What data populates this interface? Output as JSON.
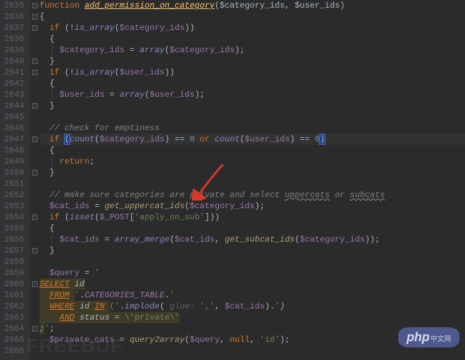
{
  "lines": {
    "start": 2635,
    "end": 2666
  },
  "code": {
    "l2635": {
      "kw": "function",
      "name": "add_permission_on_category",
      "params": "($category_ids, $user_ids)"
    },
    "l2636": "{",
    "l2637": {
      "kw": "if",
      "neg": "!",
      "fn": "is_array",
      "arg": "$category_ids"
    },
    "l2638": "{",
    "l2639": {
      "lhs": "$category_ids",
      "rhs_fn": "array",
      "rhs_arg": "$category_ids"
    },
    "l2640": "}",
    "l2641": {
      "kw": "if",
      "neg": "!",
      "fn": "is_array",
      "arg": "$user_ids"
    },
    "l2642": "{",
    "l2643": {
      "lhs": "$user_ids",
      "rhs_fn": "array",
      "rhs_arg": "$user_ids"
    },
    "l2644": "}",
    "l2645": "",
    "l2646_cmt": "// check for emptiness",
    "l2647": {
      "kw": "if",
      "fn1": "count",
      "arg1": "$category_ids",
      "eq": "==",
      "zero": "0",
      "or": "or",
      "fn2": "count",
      "arg2": "$user_ids"
    },
    "l2648": "{",
    "l2649": {
      "kw": "return"
    },
    "l2650": "}",
    "l2651": "",
    "l2652_cmt_a": "// make sure categories are private and select ",
    "l2652_cmt_b": "uppercats",
    "l2652_cmt_c": " or ",
    "l2652_cmt_d": "subcats",
    "l2653": {
      "lhs": "$cat_ids",
      "fn": "get_uppercat_ids",
      "arg": "$category_ids"
    },
    "l2654": {
      "kw": "if",
      "fn": "isset",
      "global": "$_POST",
      "key": "'apply_on_sub'"
    },
    "l2655": "{",
    "l2656": {
      "lhs": "$cat_ids",
      "fn1": "array_merge",
      "arg1": "$cat_ids",
      "fn2": "get_subcat_ids",
      "arg2": "$category_ids"
    },
    "l2657": "}",
    "l2658": "",
    "l2659": {
      "lhs": "$query",
      "str": "'"
    },
    "l2660": {
      "sql": "SELECT",
      "id": "id"
    },
    "l2661": {
      "sql": "FROM",
      "pre": "'",
      "const": "CATEGORIES_TABLE",
      "post": "'"
    },
    "l2662": {
      "sql": "WHERE",
      "id": "id",
      "in": "IN",
      "open": "('",
      "fn": "implode",
      "hint": "glue:",
      "sep": "','",
      "arr": "$cat_ids",
      "close": "').'",
      "paren": ")"
    },
    "l2663": {
      "sql": "AND",
      "id": "status",
      "eq": "=",
      "val": "\\'private\\'"
    },
    "l2664": {
      "semi": ";",
      "close": "'"
    },
    "l2665": {
      "lhs": "$private_cats",
      "fn": "query2array",
      "a1": "$query",
      "a2": "null",
      "a3": "'id'"
    },
    "l2666": ""
  },
  "watermarks": {
    "php": "php",
    "phpsub": "中文网",
    "freebuf": "FREEBUF"
  }
}
